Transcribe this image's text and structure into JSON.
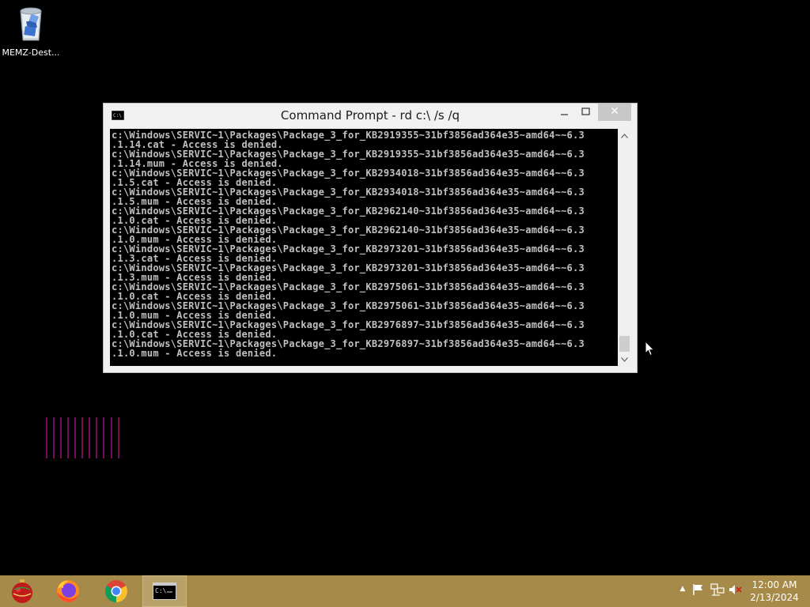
{
  "desktop": {
    "icons": [
      {
        "label": "MEMZ-Dest..."
      }
    ]
  },
  "window": {
    "title": "Command Prompt - rd  c:\\ /s /q",
    "icon_text": "C:\\",
    "close_glyph": "✕",
    "console_lines": [
      "c:\\Windows\\SERVIC~1\\Packages\\Package_3_for_KB2919355~31bf3856ad364e35~amd64~~6.3",
      ".1.14.cat - Access is denied.",
      "c:\\Windows\\SERVIC~1\\Packages\\Package_3_for_KB2919355~31bf3856ad364e35~amd64~~6.3",
      ".1.14.mum - Access is denied.",
      "c:\\Windows\\SERVIC~1\\Packages\\Package_3_for_KB2934018~31bf3856ad364e35~amd64~~6.3",
      ".1.5.cat - Access is denied.",
      "c:\\Windows\\SERVIC~1\\Packages\\Package_3_for_KB2934018~31bf3856ad364e35~amd64~~6.3",
      ".1.5.mum - Access is denied.",
      "c:\\Windows\\SERVIC~1\\Packages\\Package_3_for_KB2962140~31bf3856ad364e35~amd64~~6.3",
      ".1.0.cat - Access is denied.",
      "c:\\Windows\\SERVIC~1\\Packages\\Package_3_for_KB2962140~31bf3856ad364e35~amd64~~6.3",
      ".1.0.mum - Access is denied.",
      "c:\\Windows\\SERVIC~1\\Packages\\Package_3_for_KB2973201~31bf3856ad364e35~amd64~~6.3",
      ".1.3.cat - Access is denied.",
      "c:\\Windows\\SERVIC~1\\Packages\\Package_3_for_KB2973201~31bf3856ad364e35~amd64~~6.3",
      ".1.3.mum - Access is denied.",
      "c:\\Windows\\SERVIC~1\\Packages\\Package_3_for_KB2975061~31bf3856ad364e35~amd64~~6.3",
      ".1.0.cat - Access is denied.",
      "c:\\Windows\\SERVIC~1\\Packages\\Package_3_for_KB2975061~31bf3856ad364e35~amd64~~6.3",
      ".1.0.mum - Access is denied.",
      "c:\\Windows\\SERVIC~1\\Packages\\Package_3_for_KB2976897~31bf3856ad364e35~amd64~~6.3",
      ".1.0.cat - Access is denied.",
      "c:\\Windows\\SERVIC~1\\Packages\\Package_3_for_KB2976897~31bf3856ad364e35~amd64~~6.3",
      ".1.0.mum - Access is denied."
    ]
  },
  "taskbar": {
    "apps": [
      {
        "icon": "ornament-start-icon"
      },
      {
        "icon": "firefox-icon"
      },
      {
        "icon": "chrome-icon"
      },
      {
        "icon": "command-prompt-icon",
        "active": true
      }
    ],
    "tray": {
      "chevron": "▲"
    },
    "clock": {
      "time": "12:00 AM",
      "date": "2/13/2024"
    },
    "colors": {
      "background": "#a58a4a",
      "active_app": "#b9a16a"
    }
  }
}
